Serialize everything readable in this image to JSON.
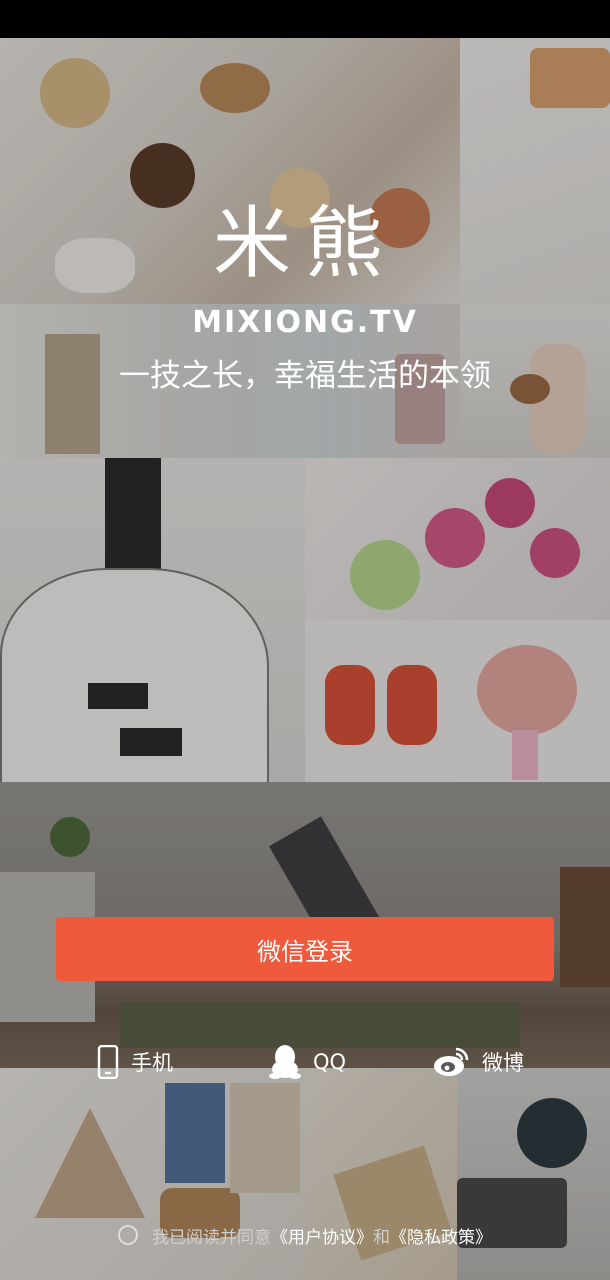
{
  "app": {
    "logo_cn": "米熊",
    "logo_en": "MIXIONG.TV",
    "slogan": "一技之长，幸福生活的本领"
  },
  "login": {
    "wechat_label": "微信登录",
    "options": [
      {
        "label": "手机",
        "icon": "phone-icon"
      },
      {
        "label": "QQ",
        "icon": "qq-penguin-icon"
      },
      {
        "label": "微博",
        "icon": "weibo-icon"
      }
    ]
  },
  "agreement": {
    "prefix": "我已阅读并同意",
    "user_agreement": "《用户协议》",
    "conjunction": "和",
    "privacy_policy": "《隐私政策》"
  },
  "colors": {
    "accent": "#ef5a3c",
    "text": "#ffffff"
  }
}
